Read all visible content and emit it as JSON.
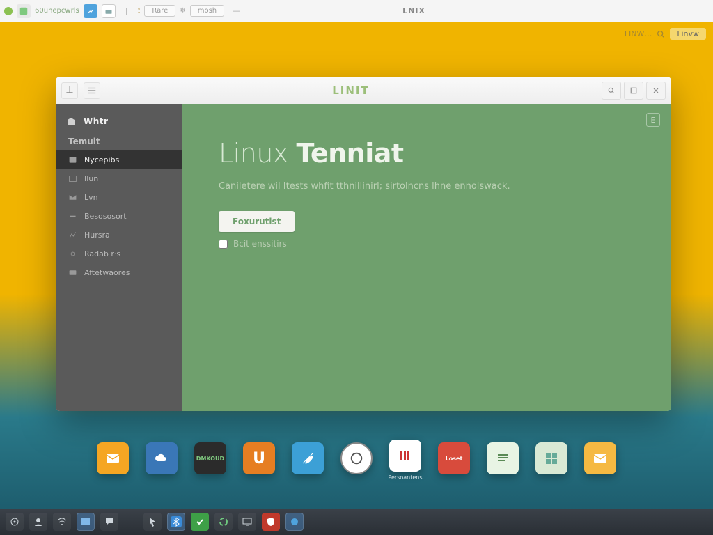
{
  "os_topbar": {
    "title_text": "LNIX",
    "address_text": "60unepcwrls",
    "tabs": [
      "Rare",
      "mosh"
    ]
  },
  "desktop_status": {
    "label": "LINW…",
    "chip": "Linvw"
  },
  "window": {
    "title": "LINIT"
  },
  "sidebar": {
    "header": "Whtr",
    "section_label": "Temuit",
    "items": [
      {
        "label": "Nycepibs"
      },
      {
        "label": "Ilun"
      },
      {
        "label": "Lvn"
      },
      {
        "label": "Besososort"
      },
      {
        "label": "Hursra"
      },
      {
        "label": "Radab r·s"
      },
      {
        "label": "Aftetwaores"
      }
    ]
  },
  "content": {
    "title_part1": "Linux",
    "title_part2": "Tenniat",
    "subtitle": "Caniletere wil Itests whfit tthnillinirl; sirtolncns lhne ennolswack.",
    "button_label": "Foxurutist",
    "checkbox_label": "Bcit enssitirs",
    "corner_label": "E"
  },
  "app_dock": {
    "items": [
      {
        "name": "mail-app",
        "color": "#f5a623",
        "shape": "mail",
        "label": ""
      },
      {
        "name": "weather-app",
        "color": "#3a77b7",
        "shape": "cloud",
        "label": ""
      },
      {
        "name": "dashboard-app",
        "color": "#2b2b2b",
        "shape": "text",
        "text": "DMKOUD",
        "label": ""
      },
      {
        "name": "utility-app",
        "color": "#e67e22",
        "shape": "u",
        "text": "U",
        "label": ""
      },
      {
        "name": "browser-app",
        "color": "#3ca0d6",
        "shape": "feather",
        "label": ""
      },
      {
        "name": "circle-app",
        "color": "#ffffff",
        "shape": "circle",
        "label": ""
      },
      {
        "name": "media-app",
        "color": "#ffffff",
        "shape": "bars",
        "label": "Persoantens"
      },
      {
        "name": "store-app",
        "color": "#d84b3c",
        "shape": "text",
        "text": "Loset",
        "label": ""
      },
      {
        "name": "files-app",
        "color": "#e8f4e4",
        "shape": "lines",
        "label": ""
      },
      {
        "name": "settings-app",
        "color": "#d9e9d5",
        "shape": "grid",
        "label": ""
      },
      {
        "name": "mail2-app",
        "color": "#f5b942",
        "shape": "mail",
        "label": ""
      }
    ]
  }
}
